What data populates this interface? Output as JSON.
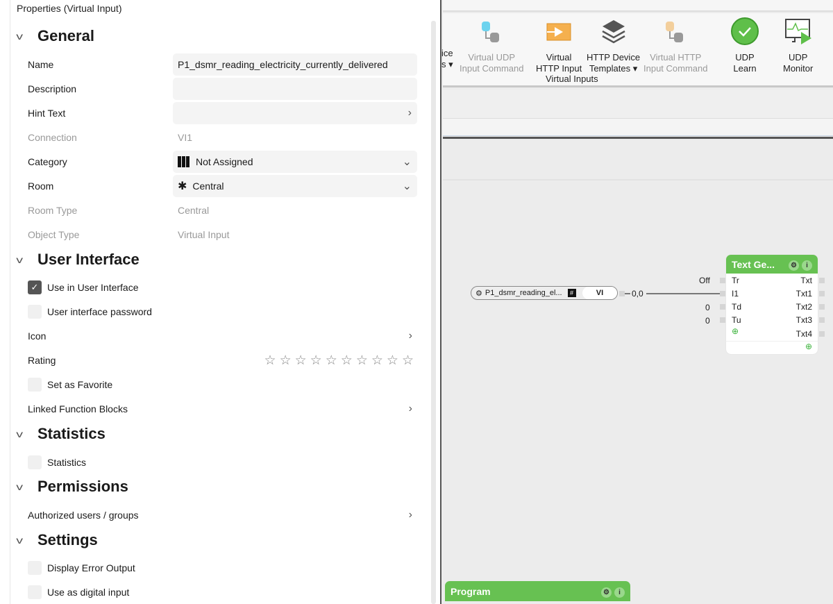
{
  "panel_title": "Properties (Virtual Input)",
  "sections": {
    "general": "General",
    "ui": "User Interface",
    "stats": "Statistics",
    "perm": "Permissions",
    "settings": "Settings"
  },
  "general": {
    "name_label": "Name",
    "name_value": "P1_dsmr_reading_electricity_currently_delivered",
    "description_label": "Description",
    "description_value": "",
    "hint_label": "Hint Text",
    "connection_label": "Connection",
    "connection_value": "VI1",
    "category_label": "Category",
    "category_value": "Not Assigned",
    "room_label": "Room",
    "room_value": "Central",
    "room_type_label": "Room Type",
    "room_type_value": "Central",
    "object_type_label": "Object Type",
    "object_type_value": "Virtual Input"
  },
  "ui": {
    "use_in_ui": "Use in User Interface",
    "use_in_ui_checked": true,
    "password": "User interface password",
    "icon": "Icon",
    "rating": "Rating",
    "rating_value": 0,
    "rating_max": 10,
    "favorite": "Set as Favorite",
    "linked": "Linked Function Blocks"
  },
  "stats": {
    "statistics": "Statistics"
  },
  "perm": {
    "authorized": "Authorized users / groups"
  },
  "settings": {
    "error_output": "Display Error Output",
    "digital_input": "Use as digital input"
  },
  "ribbon": {
    "partial_a": "ice",
    "partial_b": "s ▾",
    "items": [
      {
        "l1": "Virtual UDP",
        "l2": "Input Command",
        "disabled": true
      },
      {
        "l1": "Virtual",
        "l2": "HTTP Input",
        "disabled": false
      },
      {
        "l1": "HTTP Device",
        "l2": "Templates ▾",
        "disabled": false
      },
      {
        "l1": "Virtual HTTP",
        "l2": "Input Command",
        "disabled": true
      },
      {
        "l1": "UDP",
        "l2": "Learn",
        "disabled": false
      },
      {
        "l1": "UDP",
        "l2": "Monitor",
        "disabled": false
      }
    ],
    "group": "Virtual Inputs"
  },
  "canvas": {
    "vi_block": {
      "name": "P1_dsmr_reading_el...",
      "hash": "#",
      "label": "VI",
      "output_value": "0,0"
    },
    "text_gen": {
      "title": "Text Ge...",
      "inputs": [
        "Tr",
        "I1",
        "Td",
        "Tu"
      ],
      "input_values": [
        "Off",
        "",
        "0",
        "0"
      ],
      "outputs": [
        "Txt",
        "Txt1",
        "Txt2",
        "Txt3",
        "Txt4"
      ]
    },
    "program": {
      "title": "Program"
    }
  },
  "colors": {
    "block_green": "#67c152"
  }
}
